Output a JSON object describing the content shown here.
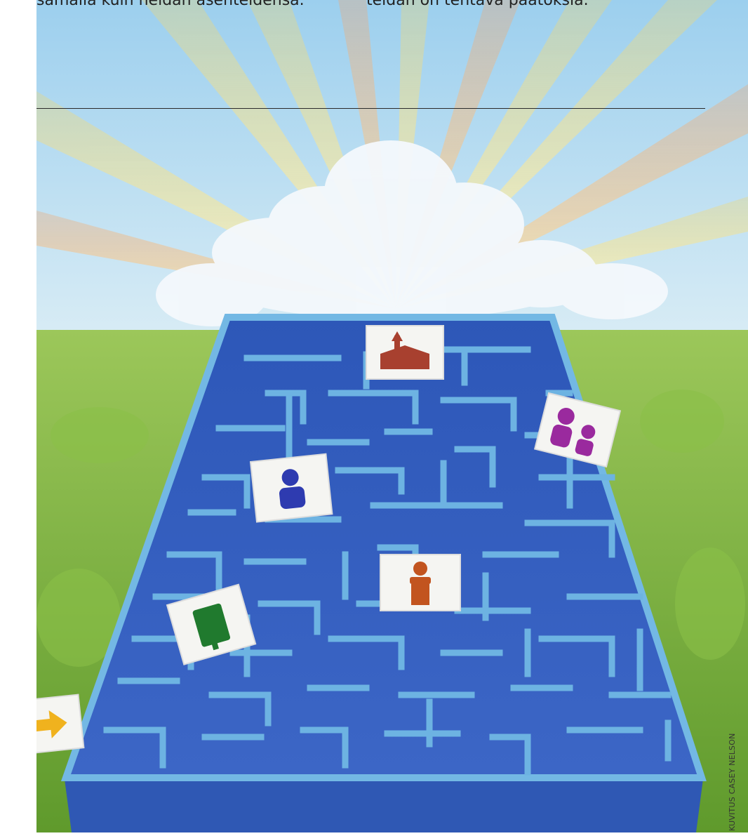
{
  "article": {
    "left_line": "samalla kuin heidän asenteidensa.",
    "right_line": "teidän on tehtävä päätöksiä."
  },
  "illustration": {
    "credit": "KUVITUS CASEY NELSON",
    "cards": [
      {
        "icon": "church-icon",
        "color": "#a8402f"
      },
      {
        "icon": "family-icon",
        "color": "#9a2a9e"
      },
      {
        "icon": "boy-icon",
        "color": "#2e3bb0"
      },
      {
        "icon": "speaker-at-pulpit-icon",
        "color": "#c2541f"
      },
      {
        "icon": "book-icon",
        "color": "#207a2e"
      },
      {
        "icon": "arrow-right-icon",
        "color": "#f0b21e"
      }
    ],
    "colors": {
      "sky": "#b9dcf1",
      "grass": "#7fb33f",
      "maze_floor": "#3659b8",
      "maze_wall": "#69b3e0"
    }
  }
}
